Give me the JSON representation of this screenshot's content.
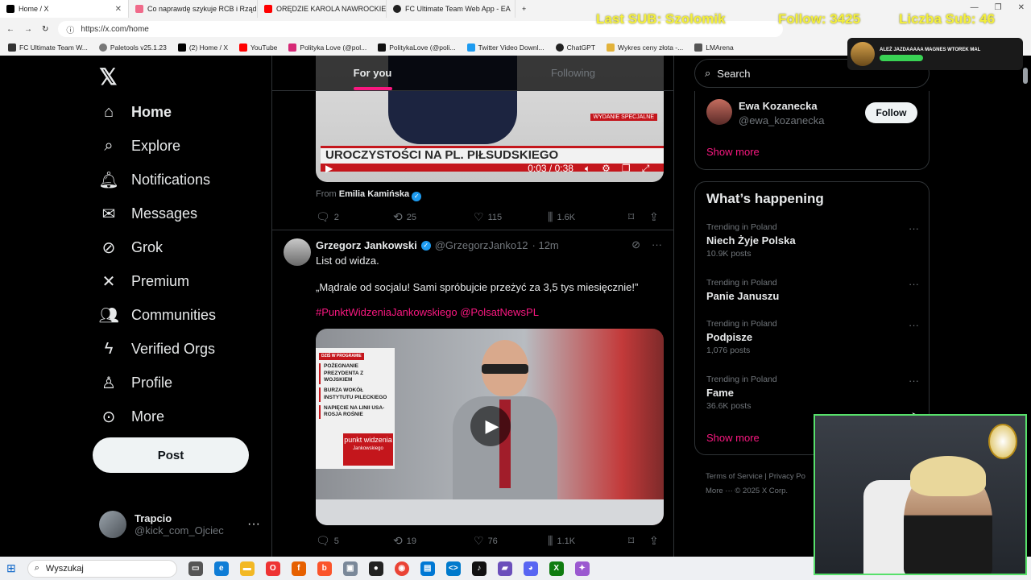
{
  "browser": {
    "tabs": [
      {
        "title": "Home / X",
        "color": "#000000"
      },
      {
        "title": "Co naprawdę szykuje RCB i Rząd",
        "color": "#f06a8a"
      },
      {
        "title": "ORĘDZIE KAROLA NAWROCKIEGO",
        "color": "#ff0000"
      },
      {
        "title": "FC Ultimate Team Web App - EA",
        "color": "#222222"
      }
    ],
    "url": "https://x.com/home",
    "bookmarks": [
      "FC Ultimate Team W...",
      "Paletools v25.1.23",
      "(2) Home / X",
      "YouTube",
      "Polityka Love (@pol...",
      "PolitykaLove (@poli...",
      "Twitter Video Downl...",
      "ChatGPT",
      "Wykres ceny złota -...",
      "LMArena"
    ]
  },
  "overlay": {
    "last_sub": "Last SUB: Szolomik",
    "follow": "Follow: 3425",
    "subs": "Liczba Sub: 46",
    "color": "#f4ef3d",
    "banner": "ALEŻ JAZDAAAAA MAGNES WTOREK MAL"
  },
  "nav": {
    "items": [
      "Home",
      "Explore",
      "Notifications",
      "Messages",
      "Grok",
      "Premium",
      "Communities",
      "Verified Orgs",
      "Profile",
      "More"
    ],
    "post": "Post",
    "account_name": "Trapcio",
    "account_handle": "@kick_com_Ojciec"
  },
  "feed": {
    "tabs": [
      "For you",
      "Following"
    ],
    "tweet1": {
      "banner": "UROCZYSTOŚCI NA PL. PIŁSUDSKIEGO",
      "badge": "WYDANIE SPECJALNE",
      "time": "0:03 / 0:38",
      "from_label": "From",
      "from_name": "Emilia Kamińska",
      "replies": "2",
      "reposts": "25",
      "likes": "115",
      "views": "1.6K"
    },
    "tweet2": {
      "name": "Grzegorz Jankowski",
      "handle": "@GrzegorzJanko12",
      "time": "· 12m",
      "line1": "List od widza.",
      "line2": "„Mądrale od socjalu! Sami spróbujcie przeżyć za 3,5 tys miesięcznie!”",
      "tags": "#PunktWidzeniaJankowskiego @PolsatNewsPL",
      "panel_header": "DZIŚ W PROGRAMIE",
      "panel_items": [
        "POŻEGNANIE PREZYDENTA Z WOJSKIEM",
        "BURZA WOKÓŁ INSTYTUTU PILECKIEGO",
        "NAPIĘCIE NA LINII USA-ROSJA ROŚNIE"
      ],
      "show_title": "punkt widzenia",
      "show_sub": "Jankowskiego",
      "replies": "5",
      "reposts": "19",
      "likes": "76",
      "views": "1.1K"
    }
  },
  "sidebar": {
    "search_placeholder": "Search",
    "who": {
      "name": "Ewa Kozanecka",
      "handle": "@ewa_kozanecka",
      "follow": "Follow"
    },
    "show_more": "Show more",
    "happening_title": "What’s happening",
    "trends": [
      {
        "context": "Trending in Poland",
        "title": "Niech Żyje Polska",
        "count": "10.9K posts"
      },
      {
        "context": "Trending in Poland",
        "title": "Panie Januszu",
        "count": ""
      },
      {
        "context": "Trending in Poland",
        "title": "Podpisze",
        "count": "1,076 posts"
      },
      {
        "context": "Trending in Poland",
        "title": "Fame",
        "count": "36.6K posts"
      }
    ],
    "footer1": "Terms of Service  |  Privacy Po",
    "footer2": "More ···   © 2025 X Corp."
  },
  "taskbar": {
    "search": "Wyszukaj"
  }
}
